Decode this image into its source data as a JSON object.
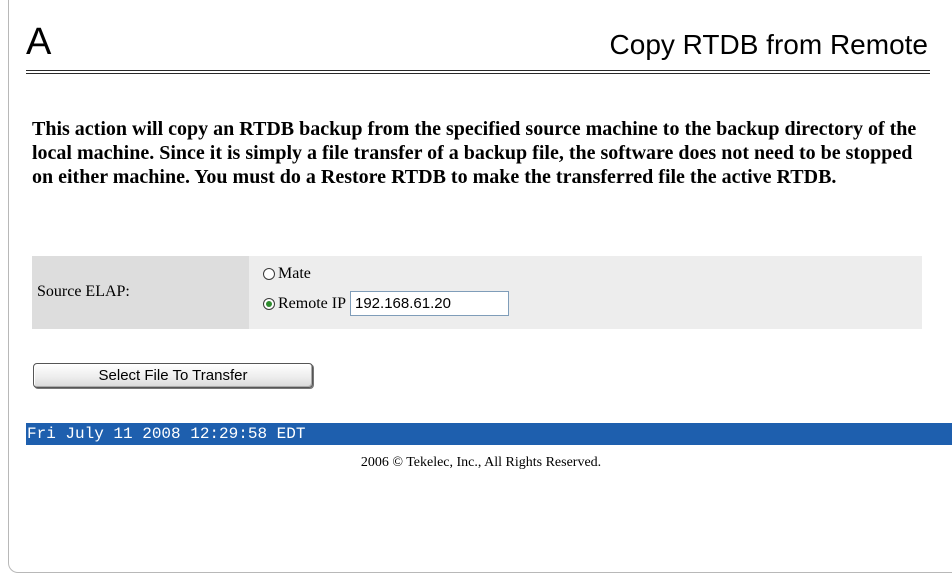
{
  "header": {
    "letter": "A",
    "title": "Copy RTDB from Remote"
  },
  "description": "This action will copy an RTDB backup from the specified source machine to the backup directory of the local machine. Since it is simply a file transfer of a backup file, the software does not need to be stopped on either machine. You must do a Restore RTDB to make the transferred file the active RTDB.",
  "form": {
    "source_label": "Source ELAP:",
    "options": [
      {
        "label": "Mate",
        "selected": false
      },
      {
        "label": "Remote IP",
        "selected": true
      }
    ],
    "remote_ip_value": "192.168.61.20"
  },
  "actions": {
    "select_file_label": "Select File To Transfer"
  },
  "status": {
    "timestamp": "Fri July 11 2008 12:29:58 EDT"
  },
  "footer": {
    "copyright": "2006 © Tekelec, Inc., All Rights Reserved."
  },
  "colors": {
    "status_bar": "#1e5fae",
    "form_background": "#ededed",
    "label_cell_background": "#dddddd"
  }
}
